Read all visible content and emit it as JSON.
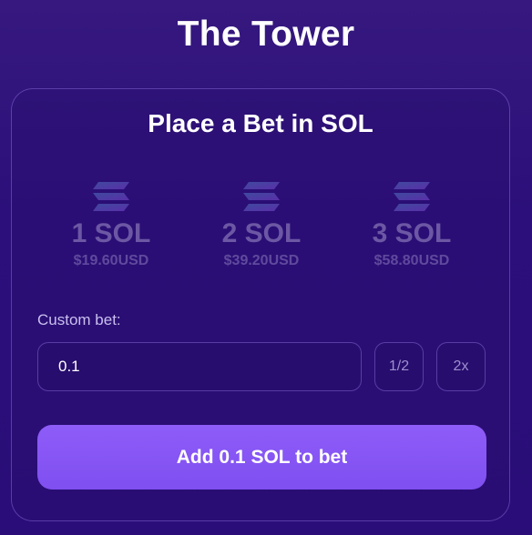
{
  "app": {
    "title": "The Tower"
  },
  "card": {
    "title": "Place a Bet in SOL"
  },
  "presets": [
    {
      "amount": "1 SOL",
      "usd": "$19.60USD",
      "icon": "solana-icon"
    },
    {
      "amount": "2 SOL",
      "usd": "$39.20USD",
      "icon": "solana-icon"
    },
    {
      "amount": "3 SOL",
      "usd": "$58.80USD",
      "icon": "solana-icon"
    }
  ],
  "custom_bet": {
    "label": "Custom bet:",
    "value": "0.1",
    "half_label": "1/2",
    "double_label": "2x"
  },
  "submit": {
    "label": "Add 0.1 SOL to bet"
  },
  "colors": {
    "background": "#2c0f7a",
    "accent": "#8e5cf8",
    "solana_top": "#5b9bd8",
    "solana_bottom": "#9b5cf0"
  }
}
